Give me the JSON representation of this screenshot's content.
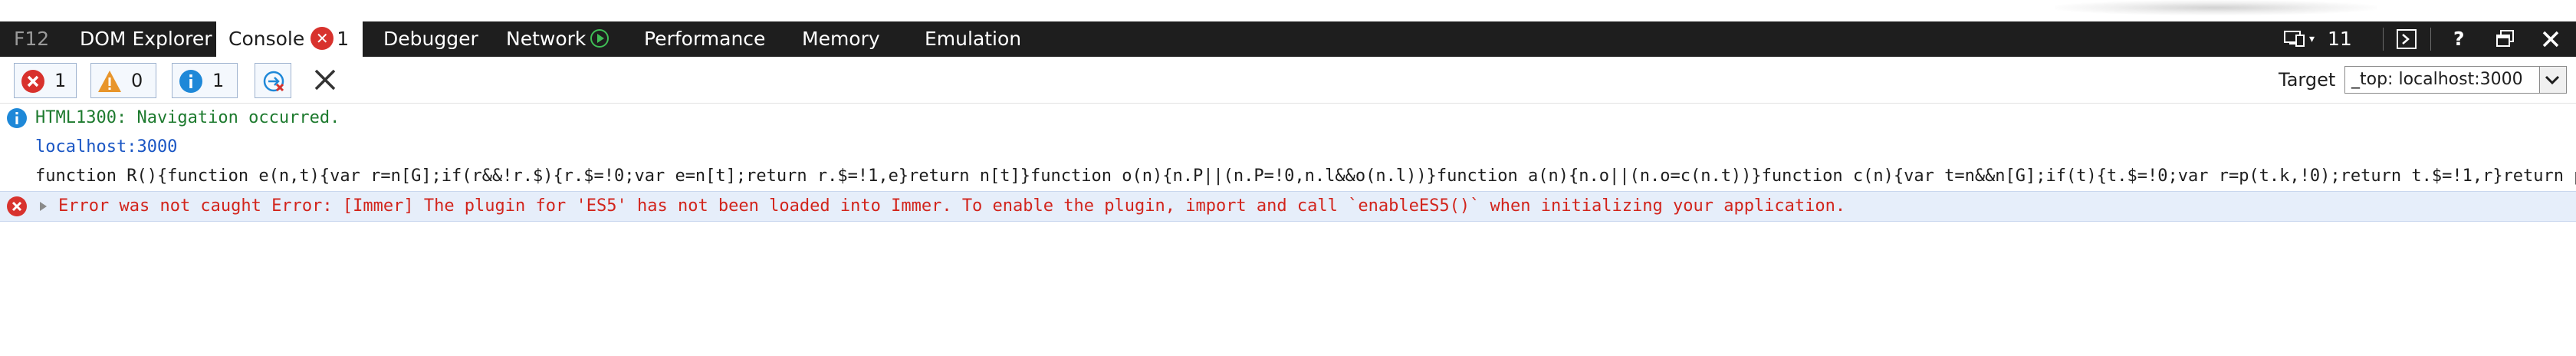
{
  "tabs": {
    "f12": "F12",
    "dom_explorer": "DOM Explorer",
    "console": "Console",
    "console_error_count": "1",
    "debugger": "Debugger",
    "network": "Network",
    "performance": "Performance",
    "memory": "Memory",
    "emulation": "Emulation"
  },
  "window_controls": {
    "device_count": "11",
    "help": "?"
  },
  "toolbar": {
    "errors_count": "1",
    "warnings_count": "0",
    "info_count": "1",
    "target_label": "Target",
    "target_value": "_top: localhost:3000"
  },
  "console": {
    "line1": "HTML1300: Navigation occurred.",
    "line2": "localhost:3000",
    "line3": "function R(){function e(n,t){var r=n[G];if(r&&!r.$){r.$=!0;var e=n[t];return r.$=!1,e}return n[t]}function o(n){n.P||(n.P=!0,n.l&&o(n.l))}function a(n){n.o||(n.o=c(n.t))}function c(n){var t=n&&n[G];if(t){t.$=!0;var r=p(t.k,!0);return t.$=!1,r}return p",
    "line4": "Error was not caught Error: [Immer] The plugin for 'ES5' has not been loaded into Immer. To enable the plugin, import and call `enableES5()` when initializing your application."
  },
  "colors": {
    "tab_bar": "#1e1e1e",
    "error_red": "#d8322d",
    "warning_orange": "#e8952b",
    "info_blue": "#1e88d8",
    "error_row_bg": "#e6eefa"
  }
}
